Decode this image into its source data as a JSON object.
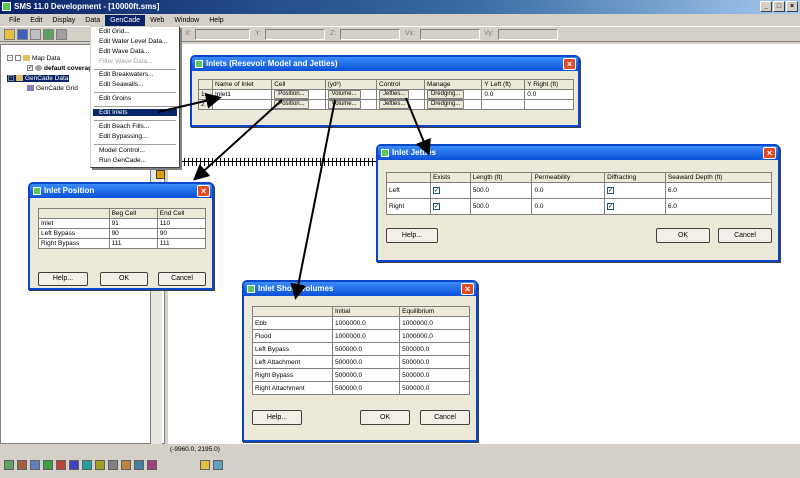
{
  "app": {
    "title": "SMS 11.0 Development - [10000ft.sms]",
    "menu": [
      "File",
      "Edit",
      "Display",
      "Data",
      "GenCade",
      "Web",
      "Window",
      "Help"
    ],
    "active_menu": "GenCade",
    "coord_labels": [
      "X:",
      "Y:",
      "Z:",
      "Vx:",
      "Vy:"
    ],
    "status_coord": "(-9960.0, 2195.0)"
  },
  "tree": {
    "items": [
      {
        "label": "Map Data"
      },
      {
        "label": "default coverage"
      },
      {
        "label": "GenCade Data"
      },
      {
        "label": "GenCade Grid"
      }
    ]
  },
  "gencade_menu": {
    "items": [
      {
        "label": "Edit Grid...",
        "disabled": false
      },
      {
        "label": "Edit Water Level Data...",
        "disabled": false
      },
      {
        "label": "Edit Wave Data...",
        "disabled": false
      },
      {
        "label": "Filter Wave Data...",
        "disabled": true
      },
      {
        "label": "Edit Breakwaters...",
        "disabled": false
      },
      {
        "label": "Edit Seawalls...",
        "disabled": false
      },
      {
        "label": "Edit Groins",
        "disabled": false
      },
      {
        "label": "Edit Inlets",
        "disabled": false,
        "highlighted": true
      },
      {
        "label": "Edit Beach Fills...",
        "disabled": false
      },
      {
        "label": "Edit Bypassing...",
        "disabled": false
      },
      {
        "label": "Model Control...",
        "disabled": false
      },
      {
        "label": "Run GenCade...",
        "disabled": false
      }
    ]
  },
  "inlets_dialog": {
    "title": "Inlets (Resevoir Model and Jetties)",
    "headers": [
      "Name of Inlet",
      "Cell",
      "(yd³)",
      "Control",
      "Manage",
      "Y Left (ft)",
      "Y Right (ft)"
    ],
    "rows": [
      {
        "num": "1",
        "name": "Inlet1",
        "cell_btn": "Position...",
        "vol_btn": "Volume...",
        "ctrl_btn": "Jetties...",
        "manage_btn": "Dredging...",
        "y_left": "0.0",
        "y_right": "0.0"
      },
      {
        "num": "2",
        "name": "",
        "cell_btn": "Position...",
        "vol_btn": "Volume...",
        "ctrl_btn": "Jetties...",
        "manage_btn": "Dredging...",
        "y_left": "",
        "y_right": ""
      }
    ]
  },
  "inlet_position_dialog": {
    "title": "Inlet Position",
    "headers": [
      "",
      "Beg Cell",
      "End Cell"
    ],
    "rows": [
      {
        "label": "Inlet",
        "beg": "91",
        "end": "110"
      },
      {
        "label": "Left Bypass",
        "beg": "90",
        "end": "90"
      },
      {
        "label": "Right Bypass",
        "beg": "111",
        "end": "111"
      }
    ],
    "help": "Help...",
    "ok": "OK",
    "cancel": "Cancel"
  },
  "inlet_jetties_dialog": {
    "title": "Inlet Jetties",
    "headers": [
      "",
      "Exists",
      "Length (ft)",
      "Permeability",
      "Diffracting",
      "Seaward Depth (ft)"
    ],
    "rows": [
      {
        "label": "Left",
        "exists": true,
        "length": "500.0",
        "perm": "0.0",
        "diffracting": true,
        "depth": "6.0"
      },
      {
        "label": "Right",
        "exists": true,
        "length": "500.0",
        "perm": "0.0",
        "diffracting": true,
        "depth": "6.0"
      }
    ],
    "help": "Help...",
    "ok": "OK",
    "cancel": "Cancel"
  },
  "shoal_dialog": {
    "title": "Inlet Shoal Volumes",
    "headers": [
      "",
      "Initial",
      "Equilibrium"
    ],
    "rows": [
      {
        "label": "Ebb",
        "initial": "1000000.0",
        "equil": "1000000.0"
      },
      {
        "label": "Flood",
        "initial": "1000000.0",
        "equil": "1000000.0"
      },
      {
        "label": "Left Bypass",
        "initial": "500000.0",
        "equil": "500000.0"
      },
      {
        "label": "Left Attachment",
        "initial": "500000.0",
        "equil": "500000.0"
      },
      {
        "label": "Right Bypass",
        "initial": "500000.0",
        "equil": "500000.0"
      },
      {
        "label": "Right Attachment",
        "initial": "500000.0",
        "equil": "500000.0"
      }
    ],
    "help": "Help...",
    "ok": "OK",
    "cancel": "Cancel"
  }
}
